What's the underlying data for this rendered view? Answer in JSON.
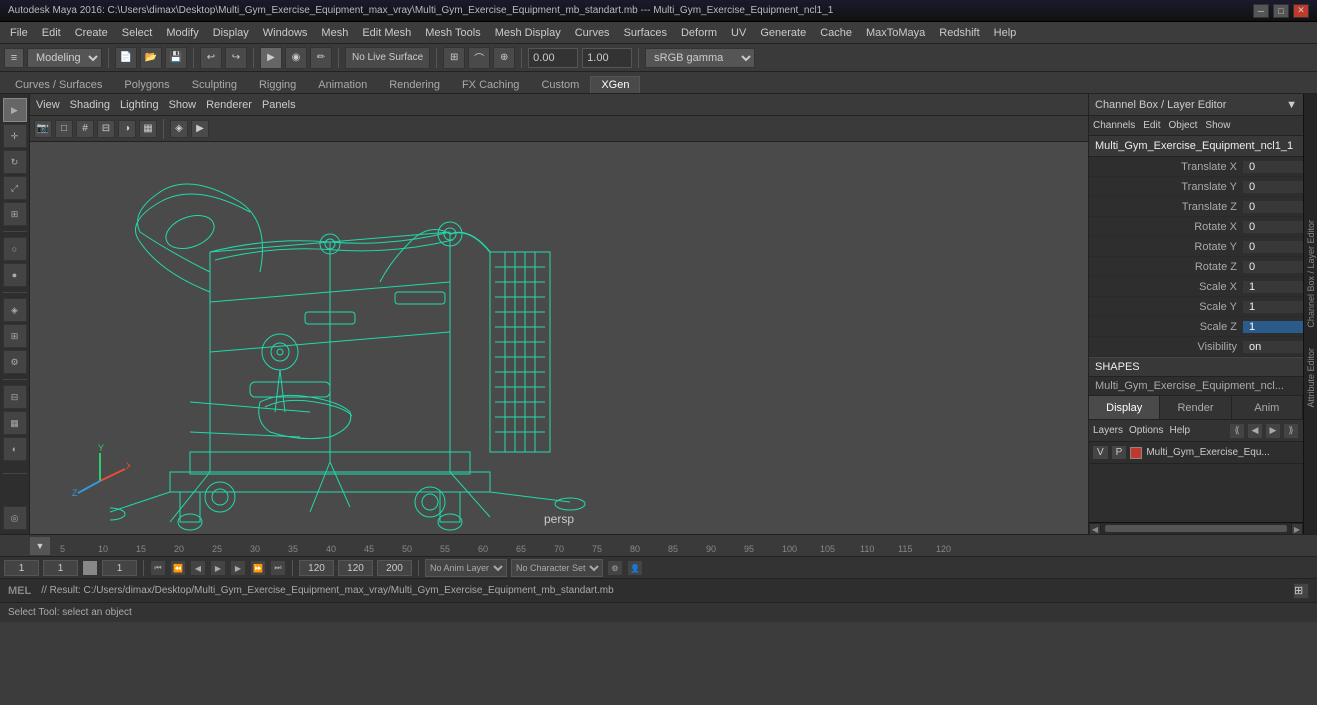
{
  "titlebar": {
    "title": "Autodesk Maya 2016: C:\\Users\\dimax\\Desktop\\Multi_Gym_Exercise_Equipment_max_vray\\Multi_Gym_Exercise_Equipment_mb_standart.mb  ---  Multi_Gym_Exercise_Equipment_ncl1_1",
    "controls": [
      "─",
      "□",
      "✕"
    ]
  },
  "menubar": {
    "items": [
      "File",
      "Edit",
      "Create",
      "Select",
      "Modify",
      "Display",
      "Windows",
      "Mesh",
      "Edit Mesh",
      "Mesh Tools",
      "Mesh Display",
      "Curves",
      "Surfaces",
      "Deform",
      "UV",
      "Generate",
      "Cache",
      "MaxToMaya",
      "Redshift",
      "Help"
    ]
  },
  "toolbar1": {
    "mode_dropdown": "Modeling",
    "live_surface": "No Live Surface",
    "gamma": "sRGB gamma",
    "translate_x_val": "0.00",
    "translate_y_val": "1.00"
  },
  "viewport_menu": {
    "items": [
      "View",
      "Shading",
      "Lighting",
      "Show",
      "Renderer",
      "Panels"
    ]
  },
  "viewport": {
    "label": "persp"
  },
  "channel_box": {
    "title": "Channel Box / Layer Editor",
    "menus": [
      "Channels",
      "Edit",
      "Object",
      "Show"
    ],
    "object_name": "Multi_Gym_Exercise_Equipment_ncl1_1",
    "properties": [
      {
        "label": "Translate X",
        "value": "0"
      },
      {
        "label": "Translate Y",
        "value": "0"
      },
      {
        "label": "Translate Z",
        "value": "0"
      },
      {
        "label": "Rotate X",
        "value": "0"
      },
      {
        "label": "Rotate Y",
        "value": "0"
      },
      {
        "label": "Rotate Z",
        "value": "0"
      },
      {
        "label": "Scale X",
        "value": "1"
      },
      {
        "label": "Scale Y",
        "value": "1"
      },
      {
        "label": "Scale Z",
        "value": "1",
        "selected": true
      },
      {
        "label": "Visibility",
        "value": "on"
      }
    ],
    "shapes_header": "SHAPES",
    "shapes_name": "Multi_Gym_Exercise_Equipment_ncl...",
    "display_tabs": [
      "Display",
      "Render",
      "Anim"
    ],
    "active_display_tab": "Display",
    "layer_menus": [
      "Layers",
      "Options",
      "Help"
    ],
    "layer_row": {
      "v": "V",
      "p": "P",
      "name": "Multi_Gym_Exercise_Equ..."
    },
    "sidebar_labels": [
      "Channel Box / Layer Editor",
      "Attribute Editor"
    ]
  },
  "timeline": {
    "ticks": [
      "5",
      "10",
      "15",
      "20",
      "25",
      "30",
      "35",
      "40",
      "45",
      "50",
      "55",
      "60",
      "65",
      "70",
      "75",
      "80",
      "85",
      "90",
      "95",
      "100",
      "105",
      "110",
      "115",
      "120"
    ],
    "current_frame": "1",
    "start_frame": "1",
    "end_frame": "120",
    "range_start": "1",
    "range_end": "120",
    "anim_layer": "No Anim Layer",
    "char_set": "No Character Set"
  },
  "bottombar": {
    "mel_label": "MEL",
    "result_text": "// Result: C:/Users/dimax/Desktop/Multi_Gym_Exercise_Equipment_max_vray/Multi_Gym_Exercise_Equipment_mb_standart.mb",
    "status": "Select Tool: select an object"
  },
  "axis": {
    "x_color": "#e74c3c",
    "y_color": "#2ecc71",
    "z_color": "#3498db"
  }
}
